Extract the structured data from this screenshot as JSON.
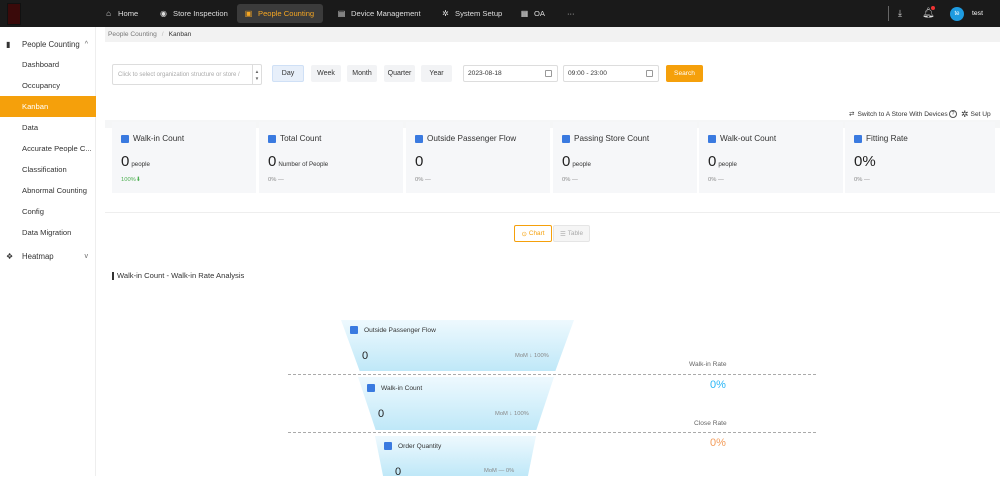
{
  "topbar": {
    "nav": [
      {
        "label": "Home",
        "icon": "home-icon",
        "active": false
      },
      {
        "label": "Store Inspection",
        "icon": "camera-icon",
        "active": false
      },
      {
        "label": "People Counting",
        "icon": "people-counting-icon",
        "active": true
      },
      {
        "label": "Device Management",
        "icon": "device-icon",
        "active": false
      },
      {
        "label": "System Setup",
        "icon": "gear-icon",
        "active": false
      },
      {
        "label": "OA",
        "icon": "calendar-icon",
        "active": false
      },
      {
        "label": "···",
        "icon": "more-icon",
        "active": false
      }
    ],
    "user": {
      "initials": "te",
      "name": "test"
    }
  },
  "sidebar": {
    "groups": [
      {
        "label": "People Counting",
        "chevron": "^"
      },
      {
        "label": "Heatmap",
        "chevron": "v"
      }
    ],
    "items": [
      {
        "label": "Dashboard"
      },
      {
        "label": "Occupancy"
      },
      {
        "label": "Kanban"
      },
      {
        "label": "Data"
      },
      {
        "label": "Accurate People C..."
      },
      {
        "label": "Classification"
      },
      {
        "label": "Abnormal Counting"
      },
      {
        "label": "Config"
      },
      {
        "label": "Data Migration"
      }
    ]
  },
  "breadcrumb": {
    "parent": "People Counting",
    "sep": "/",
    "current": "Kanban"
  },
  "filter": {
    "org_placeholder": "Click to select organization structure or store /",
    "periods": [
      "Day",
      "Week",
      "Month",
      "Quarter",
      "Year"
    ],
    "date": "2023-08-18",
    "time": "09:00 - 23:00",
    "search_label": "Search"
  },
  "options": {
    "switch_label": "Switch to A Store With Devices",
    "setup_label": "Set Up"
  },
  "kpis": [
    {
      "title": "Walk-in Count",
      "value": "0",
      "unit": "people",
      "foot": "100%⬇",
      "foot_green": true
    },
    {
      "title": "Total Count",
      "value": "0",
      "unit": "Number of People",
      "foot": "0% —",
      "foot_green": false
    },
    {
      "title": "Outside Passenger Flow",
      "value": "0",
      "unit": "",
      "foot": "0% —",
      "foot_green": false
    },
    {
      "title": "Passing Store Count",
      "value": "0",
      "unit": "people",
      "foot": "0% —",
      "foot_green": false
    },
    {
      "title": "Walk-out Count",
      "value": "0",
      "unit": "people",
      "foot": "0% —",
      "foot_green": false
    },
    {
      "title": "Fitting Rate",
      "value": "0%",
      "unit": "",
      "foot": "0% —",
      "foot_green": false
    }
  ],
  "view_toggle": {
    "chart": "Chart",
    "table": "Table"
  },
  "analysis": {
    "title": "Walk-in Count - Walk-in Rate Analysis",
    "stages": [
      {
        "label": "Outside Passenger Flow",
        "value": "0",
        "mom": "MoM ↓ 100%"
      },
      {
        "label": "Walk-in Count",
        "value": "0",
        "mom": "MoM ↓ 100%"
      },
      {
        "label": "Order Quantity",
        "value": "0",
        "mom": "MoM — 0%"
      }
    ],
    "rates": [
      {
        "label": "Walk-in Rate",
        "value": "0%",
        "color": "#29b6f6"
      },
      {
        "label": "Close Rate",
        "value": "0%",
        "color": "#f39c5a"
      }
    ]
  }
}
